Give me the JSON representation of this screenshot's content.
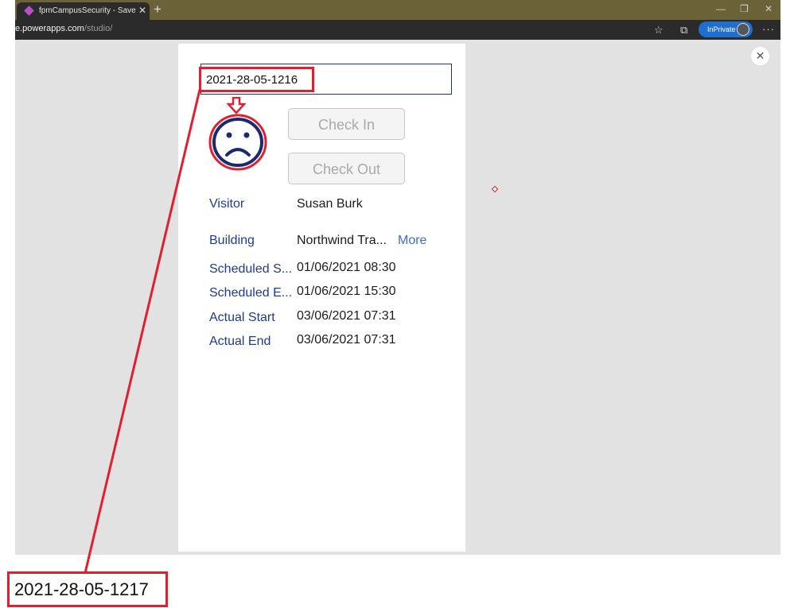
{
  "browser": {
    "tab_title": "fpmCampusSecurity - Saved (Un",
    "tab_close": "✕",
    "new_tab": "+",
    "minimize": "—",
    "restore": "❐",
    "close": "✕",
    "url_host": "e.powerapps.com",
    "url_path": "/studio/",
    "inprivate_label": "InPrivate",
    "more_menu": "···",
    "icons": [
      "favorites-star-icon",
      "collections-icon",
      "avatar",
      "more-icon"
    ]
  },
  "studio": {
    "close_glyph": "✕"
  },
  "app": {
    "search_value": "2021-28-05-1216",
    "check_in_label": "Check In",
    "check_out_label": "Check Out",
    "status_icon": "sad-face-icon",
    "details": [
      {
        "label": "Visitor",
        "value": "Susan Burk"
      },
      {
        "label": "Building",
        "value": "Northwind Tra..."
      },
      {
        "label": "Scheduled S...",
        "value": "01/06/2021 08:30"
      },
      {
        "label": "Scheduled E...",
        "value": "01/06/2021 15:30"
      },
      {
        "label": "Actual Start",
        "value": "03/06/2021 07:31"
      },
      {
        "label": "Actual End",
        "value": "03/06/2021 07:31"
      }
    ],
    "more_link": "More"
  },
  "annotation": {
    "callout_text": "2021-28-05-1217",
    "highlight_color": "#e02030"
  },
  "colors": {
    "label": "#1f3a93",
    "accent_blue": "#1f6fd1",
    "face": "#1a2a6c"
  }
}
